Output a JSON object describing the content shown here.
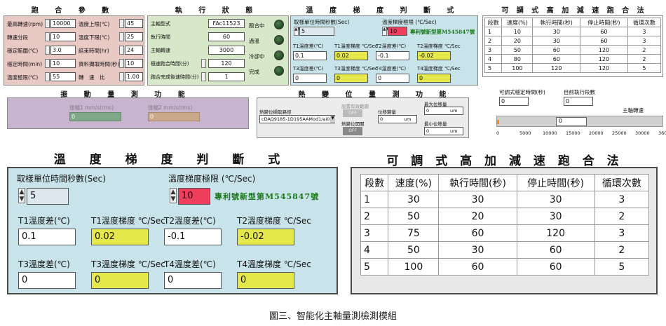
{
  "run_params": {
    "title": "跑 合 參 數",
    "fields": [
      {
        "label": "最高轉速(rpm)",
        "value": "10000"
      },
      {
        "label": "轉速分段",
        "value": "10"
      },
      {
        "label": "穩定範圍(℃)",
        "value": "3.0"
      },
      {
        "label": "穩定時間(min)",
        "value": "10"
      },
      {
        "label": "溫度極限(℃)",
        "value": "55"
      }
    ],
    "fields2": [
      {
        "label": "溫度上限(℃)",
        "value": "45"
      },
      {
        "label": "溫度下限(℃)",
        "value": "25"
      },
      {
        "label": "結束時間(hr)",
        "value": "24"
      },
      {
        "label": "資料擷取時間(秒)",
        "value": "10"
      },
      {
        "label": "轉　速　比",
        "value": "1.00"
      }
    ]
  },
  "exec_status": {
    "title": "執 行 狀 態",
    "fields": [
      {
        "label": "主軸型式",
        "value": "FAc11523"
      },
      {
        "label": "執行時間",
        "value": "60"
      },
      {
        "label": "主軸轉速",
        "value": "3000"
      },
      {
        "label": "極速跑合時間(分)",
        "value": "120"
      },
      {
        "label": "跑合完成後速時間(分)",
        "value": "1"
      }
    ],
    "leds": [
      "跑合中",
      "過溫",
      "冷卻中",
      "完成"
    ]
  },
  "temp_small": {
    "title": "溫 度 梯 度 判 斷 式",
    "sample_label": "取樣單位時間秒數(Sec)",
    "sample_value": "5",
    "limit_label": "溫度梯度極限 (℃/Sec)",
    "limit_value": "10",
    "patent": "專利號新型第M545847號",
    "row1": [
      {
        "label": "T1溫度差(℃)",
        "value": "0.1"
      },
      {
        "label": "T1溫度梯度 ℃/Sec",
        "value": "0.02"
      },
      {
        "label": "T2溫度差(℃)",
        "value": "-0.1"
      },
      {
        "label": "T2溫度梯度 ℃/Sec",
        "value": "-0.02"
      }
    ],
    "row2": [
      {
        "label": "T3溫度差(℃)",
        "value": "0"
      },
      {
        "label": "T3溫度梯度 ℃/Sec",
        "value": "0"
      },
      {
        "label": "T4溫度差(℃)",
        "value": "0"
      },
      {
        "label": "T4溫度梯度 ℃/Sec",
        "value": "0"
      }
    ]
  },
  "accel_small": {
    "title": "可 調 式 高 加 減 速 跑 合 法",
    "headers": [
      "段數",
      "速度(%)",
      "執行時間(秒)",
      "停止時間(秒)",
      "循環次數"
    ],
    "rows": [
      [
        "1",
        "10",
        "30",
        "60",
        "3"
      ],
      [
        "2",
        "20",
        "30",
        "60",
        "3"
      ],
      [
        "3",
        "50",
        "60",
        "120",
        "2"
      ],
      [
        "4",
        "80",
        "60",
        "120",
        "2"
      ],
      [
        "5",
        "100",
        "120",
        "120",
        "5"
      ]
    ],
    "stable_label": "可調式穩定時間(秒)",
    "stable_value": "0",
    "segment_label": "目前執行段數",
    "segment_value": "0",
    "speed_label": "主軸轉速",
    "slider_ticks": [
      "0",
      "5000",
      "10000",
      "15000",
      "20000",
      "25000",
      "30000",
      "36000"
    ],
    "slider_value": "0"
  },
  "vibration": {
    "title": "振 動 量 測 功 能",
    "t1_label": "振幅1 mm/s(rms)",
    "t1_value": "0",
    "t2_label": "振幅2 mm/s(rms)",
    "t2_value": "0"
  },
  "thermal": {
    "title": "熱 變 位 量 測 功 能",
    "path_label": "熱變位擷取路徑",
    "path_value": "cDAQ9185-1D195AAMod1/ai0",
    "zero_label": "設置有效範圍",
    "zero_btn": "OFF",
    "enable_label": "熱變位開關",
    "enable_btn": "OFF",
    "disp_label": "位移變量",
    "disp_value": "0",
    "disp_unit": "um",
    "max_label": "最大位移量",
    "max_value": "0",
    "max_unit": "um",
    "min_label": "最小位移量",
    "min_value": "0",
    "min_unit": "um"
  },
  "temp_big": {
    "title": "溫 度 梯 度 判 斷 式",
    "sample_label": "取樣單位時間秒數(Sec)",
    "sample_value": "5",
    "limit_label": "溫度梯度極限 (℃/Sec)",
    "limit_value": "10",
    "patent": "專利號新型第M545847號",
    "row1": [
      {
        "label": "T1溫度差(℃)",
        "value": "0.1"
      },
      {
        "label": "T1溫度梯度 ℃/Sec",
        "value": "0.02"
      },
      {
        "label": "T2溫度差(℃)",
        "value": "-0.1"
      },
      {
        "label": "T2溫度梯度 ℃/Sec",
        "value": "-0.02"
      }
    ],
    "row2": [
      {
        "label": "T3溫度差(℃)",
        "value": "0"
      },
      {
        "label": "T3溫度梯度 ℃/Sec",
        "value": "0"
      },
      {
        "label": "T4溫度差(℃)",
        "value": "0"
      },
      {
        "label": "T4溫度梯度 ℃/Sec",
        "value": "0"
      }
    ]
  },
  "accel_big": {
    "title": "可 調 式 高 加 減 速 跑 合 法",
    "headers": [
      "段數",
      "速度(%)",
      "執行時間(秒)",
      "停止時間(秒)",
      "循環次數"
    ],
    "rows": [
      [
        "1",
        "30",
        "30",
        "30",
        "3"
      ],
      [
        "2",
        "50",
        "20",
        "30",
        "2"
      ],
      [
        "3",
        "75",
        "60",
        "120",
        "3"
      ],
      [
        "4",
        "50",
        "30",
        "60",
        "2"
      ],
      [
        "5",
        "100",
        "60",
        "60",
        "5"
      ]
    ]
  },
  "caption": "圖三、智能化主軸量測檢測模組",
  "colors": {
    "pink": "#e9c9c4",
    "green": "#d7e8c8",
    "cyan": "#c9e3ea",
    "yellow": "#e4e84a",
    "red": "#ee3d5d",
    "patent": "#1a7a1a"
  }
}
